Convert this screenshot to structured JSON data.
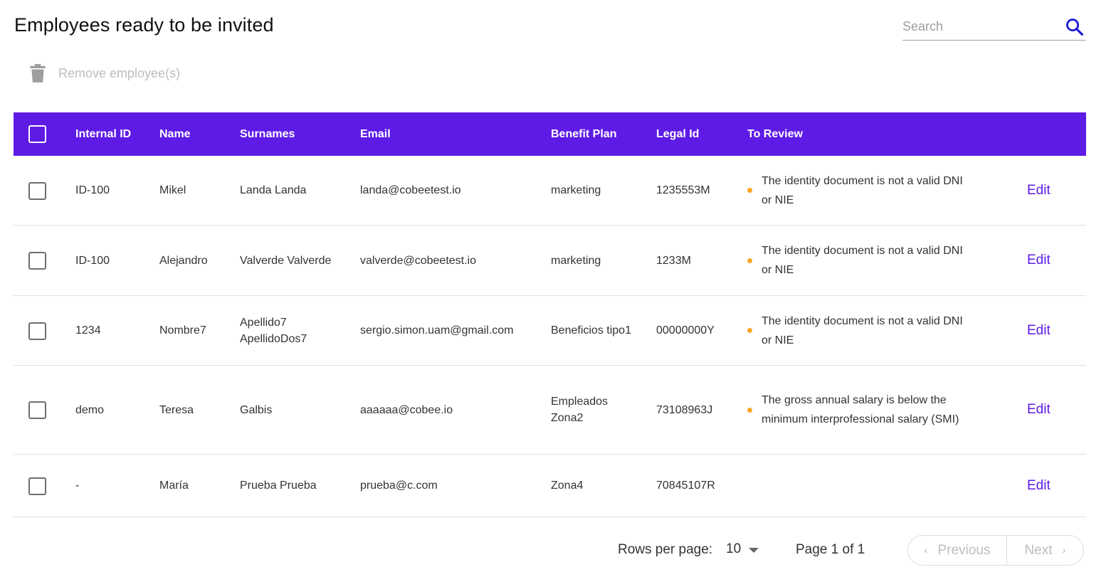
{
  "header": {
    "title": "Employees ready to be invited",
    "search_placeholder": "Search",
    "search_value": ""
  },
  "toolbar": {
    "remove_label": "Remove employee(s)"
  },
  "table": {
    "columns": [
      "Internal ID",
      "Name",
      "Surnames",
      "Email",
      "Benefit Plan",
      "Legal Id",
      "To Review"
    ],
    "edit_label": "Edit",
    "rows": [
      {
        "internal_id": "ID-100",
        "name": "Mikel",
        "surnames": "Landa Landa",
        "email": "landa@cobeetest.io",
        "benefit_plan": "marketing",
        "legal_id": "1235553M",
        "to_review": "The identity document is not a valid DNI or NIE"
      },
      {
        "internal_id": "ID-100",
        "name": "Alejandro",
        "surnames": "Valverde Valverde",
        "email": "valverde@cobeetest.io",
        "benefit_plan": "marketing",
        "legal_id": "1233M",
        "to_review": "The identity document is not a valid DNI or NIE"
      },
      {
        "internal_id": "1234",
        "name": "Nombre7",
        "surnames": "Apellido7 ApellidoDos7",
        "email": "sergio.simon.uam@gmail.com",
        "benefit_plan": "Beneficios tipo1",
        "legal_id": "00000000Y",
        "to_review": "The identity document is not a valid DNI or NIE"
      },
      {
        "internal_id": "demo",
        "name": "Teresa",
        "surnames": "Galbis",
        "email": "aaaaaa@cobee.io",
        "benefit_plan": "Empleados Zona2",
        "legal_id": "73108963J",
        "to_review": "The gross annual salary is below the minimum interprofessional salary (SMI)"
      },
      {
        "internal_id": "-",
        "name": "María",
        "surnames": "Prueba Prueba",
        "email": "prueba@c.com",
        "benefit_plan": "Zona4",
        "legal_id": "70845107R",
        "to_review": ""
      }
    ]
  },
  "pagination": {
    "rows_per_page_label": "Rows per page:",
    "rows_per_page_value": "10",
    "page_info": "Page 1 of 1",
    "previous_label": "Previous",
    "next_label": "Next"
  },
  "colors": {
    "header_bg": "#5e1be6",
    "accent": "#5e1be6",
    "warning_dot": "#f5a623",
    "search_icon": "#1a1ad6"
  }
}
